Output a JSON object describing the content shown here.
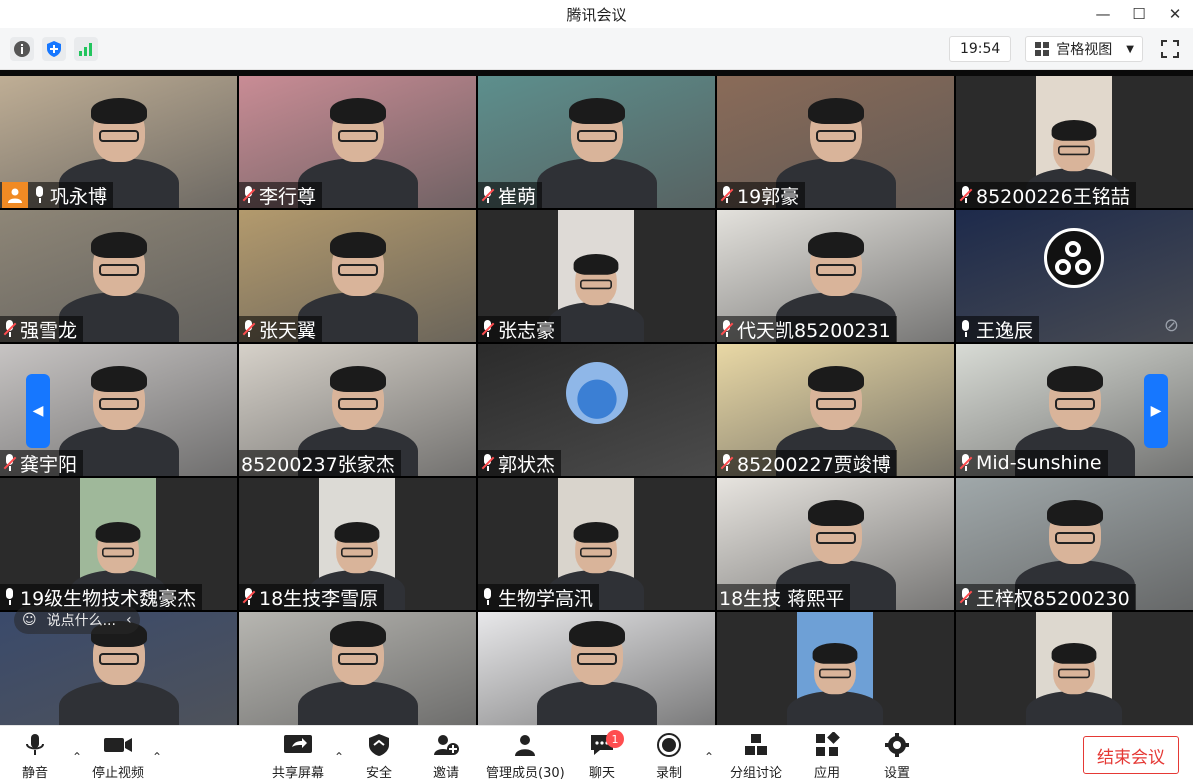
{
  "window": {
    "title": "腾讯会议",
    "controls": [
      "—",
      "☐",
      "✕"
    ]
  },
  "toolbar": {
    "time": "19:54",
    "view_label": "宫格视图"
  },
  "gallery": {
    "chat_placeholder": "说点什么...",
    "tiles": [
      {
        "name": "巩永博",
        "mic": "on",
        "host": true,
        "active": true,
        "bg": "#bfae95"
      },
      {
        "name": "李行尊",
        "mic": "muted",
        "bg": "#c98c95"
      },
      {
        "name": "崔萌",
        "mic": "muted",
        "bg": "#5d8f8d"
      },
      {
        "name": "19郭豪",
        "mic": "muted",
        "bg": "#8a6b58"
      },
      {
        "name": "85200226王铭喆",
        "mic": "muted",
        "bg": "#e1d8cc",
        "portrait": true
      },
      {
        "name": "强雪龙",
        "mic": "muted",
        "bg": "#8e8677"
      },
      {
        "name": "张天翼",
        "mic": "muted",
        "bg": "#b39a6d"
      },
      {
        "name": "张志豪",
        "mic": "muted",
        "bg": "#dedad6",
        "portrait": true
      },
      {
        "name": "代天凯85200231",
        "mic": "muted",
        "bg": "#e3e1dc"
      },
      {
        "name": "王逸辰",
        "mic": "on",
        "bg": "#1d2a4b",
        "avatar": "obs"
      },
      {
        "name": "龚宇阳",
        "mic": "muted",
        "bg": "#c7c4c3"
      },
      {
        "name": "85200237张家杰",
        "mic": "none",
        "bg": "#d6d1c9"
      },
      {
        "name": "郭状杰",
        "mic": "muted",
        "bg": "#2b2b2b",
        "avatar": "round"
      },
      {
        "name": "85200227贾竣博",
        "mic": "muted",
        "bg": "#e9d8a5"
      },
      {
        "name": "Mid-sunshine",
        "mic": "muted",
        "bg": "#d8dbd5"
      },
      {
        "name": "19级生物技术魏豪杰",
        "mic": "on",
        "bg": "#9fb89a",
        "portrait": true
      },
      {
        "name": "18生技李雪原",
        "mic": "muted",
        "bg": "#dcdad5",
        "portrait": true
      },
      {
        "name": "生物学高汛",
        "mic": "on",
        "bg": "#d9d4cc",
        "portrait": true
      },
      {
        "name": "18生技 蒋熙平",
        "mic": "none",
        "bg": "#e7e4df"
      },
      {
        "name": "王梓权85200230",
        "mic": "muted",
        "bg": "#a0a8aa"
      },
      {
        "name": "",
        "mic": "none",
        "bg": "#3a4a6b"
      },
      {
        "name": "",
        "mic": "none",
        "bg": "#b7b6b1"
      },
      {
        "name": "",
        "mic": "none",
        "bg": "#e8e8ea"
      },
      {
        "name": "",
        "mic": "none",
        "bg": "#6ea0d6",
        "portrait": true
      },
      {
        "name": "",
        "mic": "none",
        "bg": "#ddd8cf",
        "portrait": true
      }
    ]
  },
  "controls": {
    "mute": "静音",
    "stop_video": "停止视频",
    "share_screen": "共享屏幕",
    "security": "安全",
    "invite": "邀请",
    "manage_members": "管理成员(30)",
    "chat": "聊天",
    "chat_badge": "1",
    "record": "录制",
    "breakout": "分组讨论",
    "apps": "应用",
    "settings": "设置",
    "end_meeting": "结束会议"
  },
  "colors": {
    "accent": "#1677ff",
    "end": "#e53935",
    "host": "#f08a24",
    "muted": "#ff4d4f"
  }
}
